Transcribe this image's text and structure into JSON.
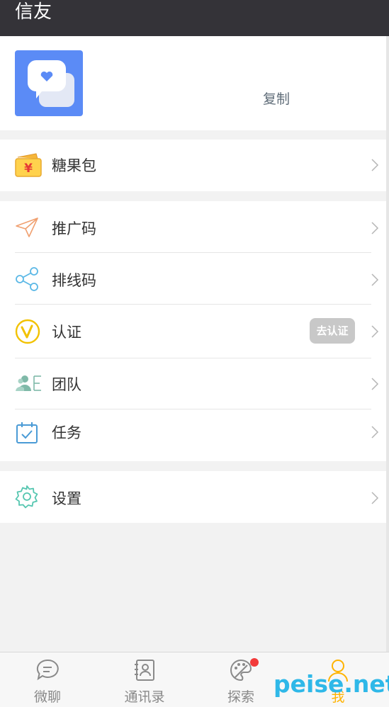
{
  "header": {
    "title": "信友"
  },
  "profile": {
    "copy_label": "复制",
    "avatar_icon": "chat-heart-icon"
  },
  "wallet": {
    "label": "糖果包",
    "icon": "wallet-yen-icon"
  },
  "menu": [
    {
      "label": "推广码",
      "icon": "paper-plane-icon"
    },
    {
      "label": "排线码",
      "icon": "share-icon"
    },
    {
      "label": "认证",
      "icon": "verify-v-icon",
      "badge": "去认证"
    },
    {
      "label": "团队",
      "icon": "team-icon"
    },
    {
      "label": "任务",
      "icon": "calendar-check-icon"
    }
  ],
  "settings": {
    "label": "设置",
    "icon": "gear-icon"
  },
  "tabbar": [
    {
      "label": "微聊",
      "icon": "chat-bubble-icon"
    },
    {
      "label": "通讯录",
      "icon": "contacts-icon"
    },
    {
      "label": "探索",
      "icon": "palette-icon"
    },
    {
      "label": "我",
      "icon": "person-icon",
      "active": true
    }
  ],
  "watermark": "peise.net",
  "colors": {
    "header": "#343338",
    "avatar": "#5b8bf6",
    "active_tab": "#ffb300",
    "badge": "#c8c8c8"
  }
}
